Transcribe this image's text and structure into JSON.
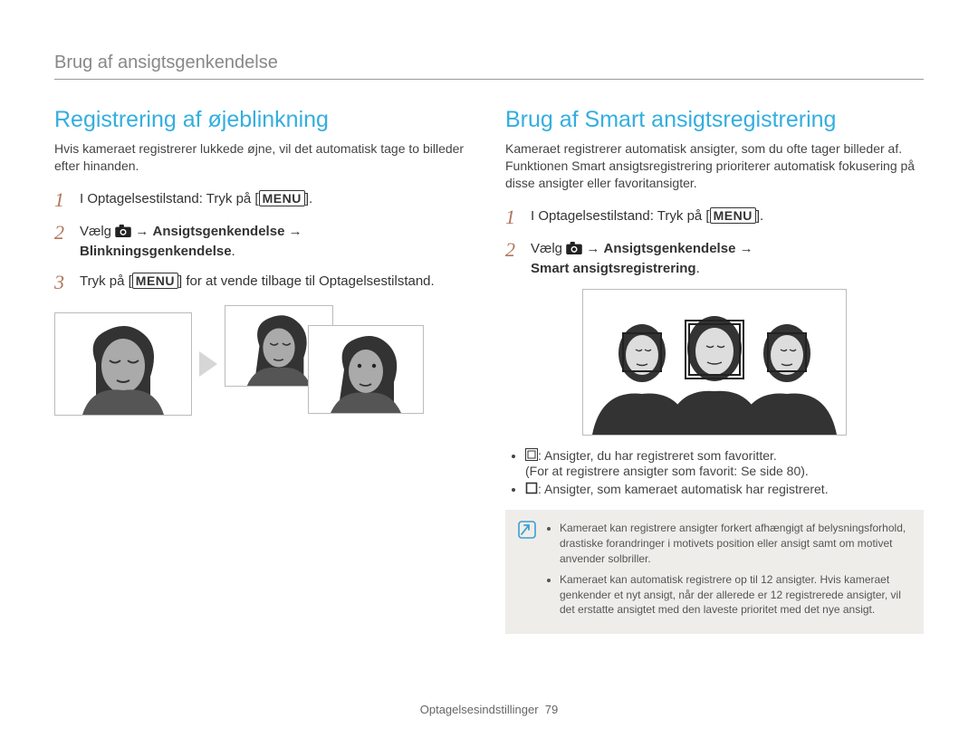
{
  "header": "Brug af ansigtsgenkendelse",
  "left": {
    "title": "Registrering af øjeblinkning",
    "intro": "Hvis kameraet registrerer lukkede øjne, vil det automatisk tage to billeder efter hinanden.",
    "step1_pre": "I Optagelsestilstand: Tryk på [",
    "menu": "MENU",
    "step1_post": "].",
    "step2_pre": "Vælg ",
    "step2_arrow": " → ",
    "step2_b1": "Ansigtsgenkendelse",
    "step2_b2": "Blinkningsgenkendelse",
    "step2_end": ".",
    "step3_pre": "Tryk på [",
    "step3_post": "] for at vende tilbage til Optagelsestilstand."
  },
  "right": {
    "title": "Brug af Smart ansigtsregistrering",
    "intro": "Kameraet registrerer automatisk ansigter, som du ofte tager billeder af. Funktionen Smart ansigtsregistrering prioriterer automatisk fokusering på disse ansigter eller favoritansigter.",
    "step1_pre": "I Optagelsestilstand: Tryk på [",
    "menu": "MENU",
    "step1_post": "].",
    "step2_pre": "Vælg ",
    "step2_arrow": " → ",
    "step2_b1": "Ansigtsgenkendelse",
    "step2_b2": "Smart ansigtsregistrering",
    "step2_end": ".",
    "bullet1_a": ": Ansigter, du har registreret som favoritter.",
    "bullet1_b": "(For at registrere ansigter som favorit: Se side 80).",
    "bullet2": ": Ansigter, som kameraet automatisk har registreret.",
    "note1": "Kameraet kan registrere ansigter forkert afhængigt af belysningsforhold, drastiske forandringer i motivets position eller ansigt samt om motivet anvender solbriller.",
    "note2": "Kameraet kan automatisk registrere op til 12 ansigter. Hvis kameraet genkender et nyt ansigt, når der allerede er 12 registrerede ansigter, vil det erstatte ansigtet med den laveste prioritet med det nye ansigt."
  },
  "footer_label": "Optagelsesindstillinger",
  "footer_page": "79"
}
